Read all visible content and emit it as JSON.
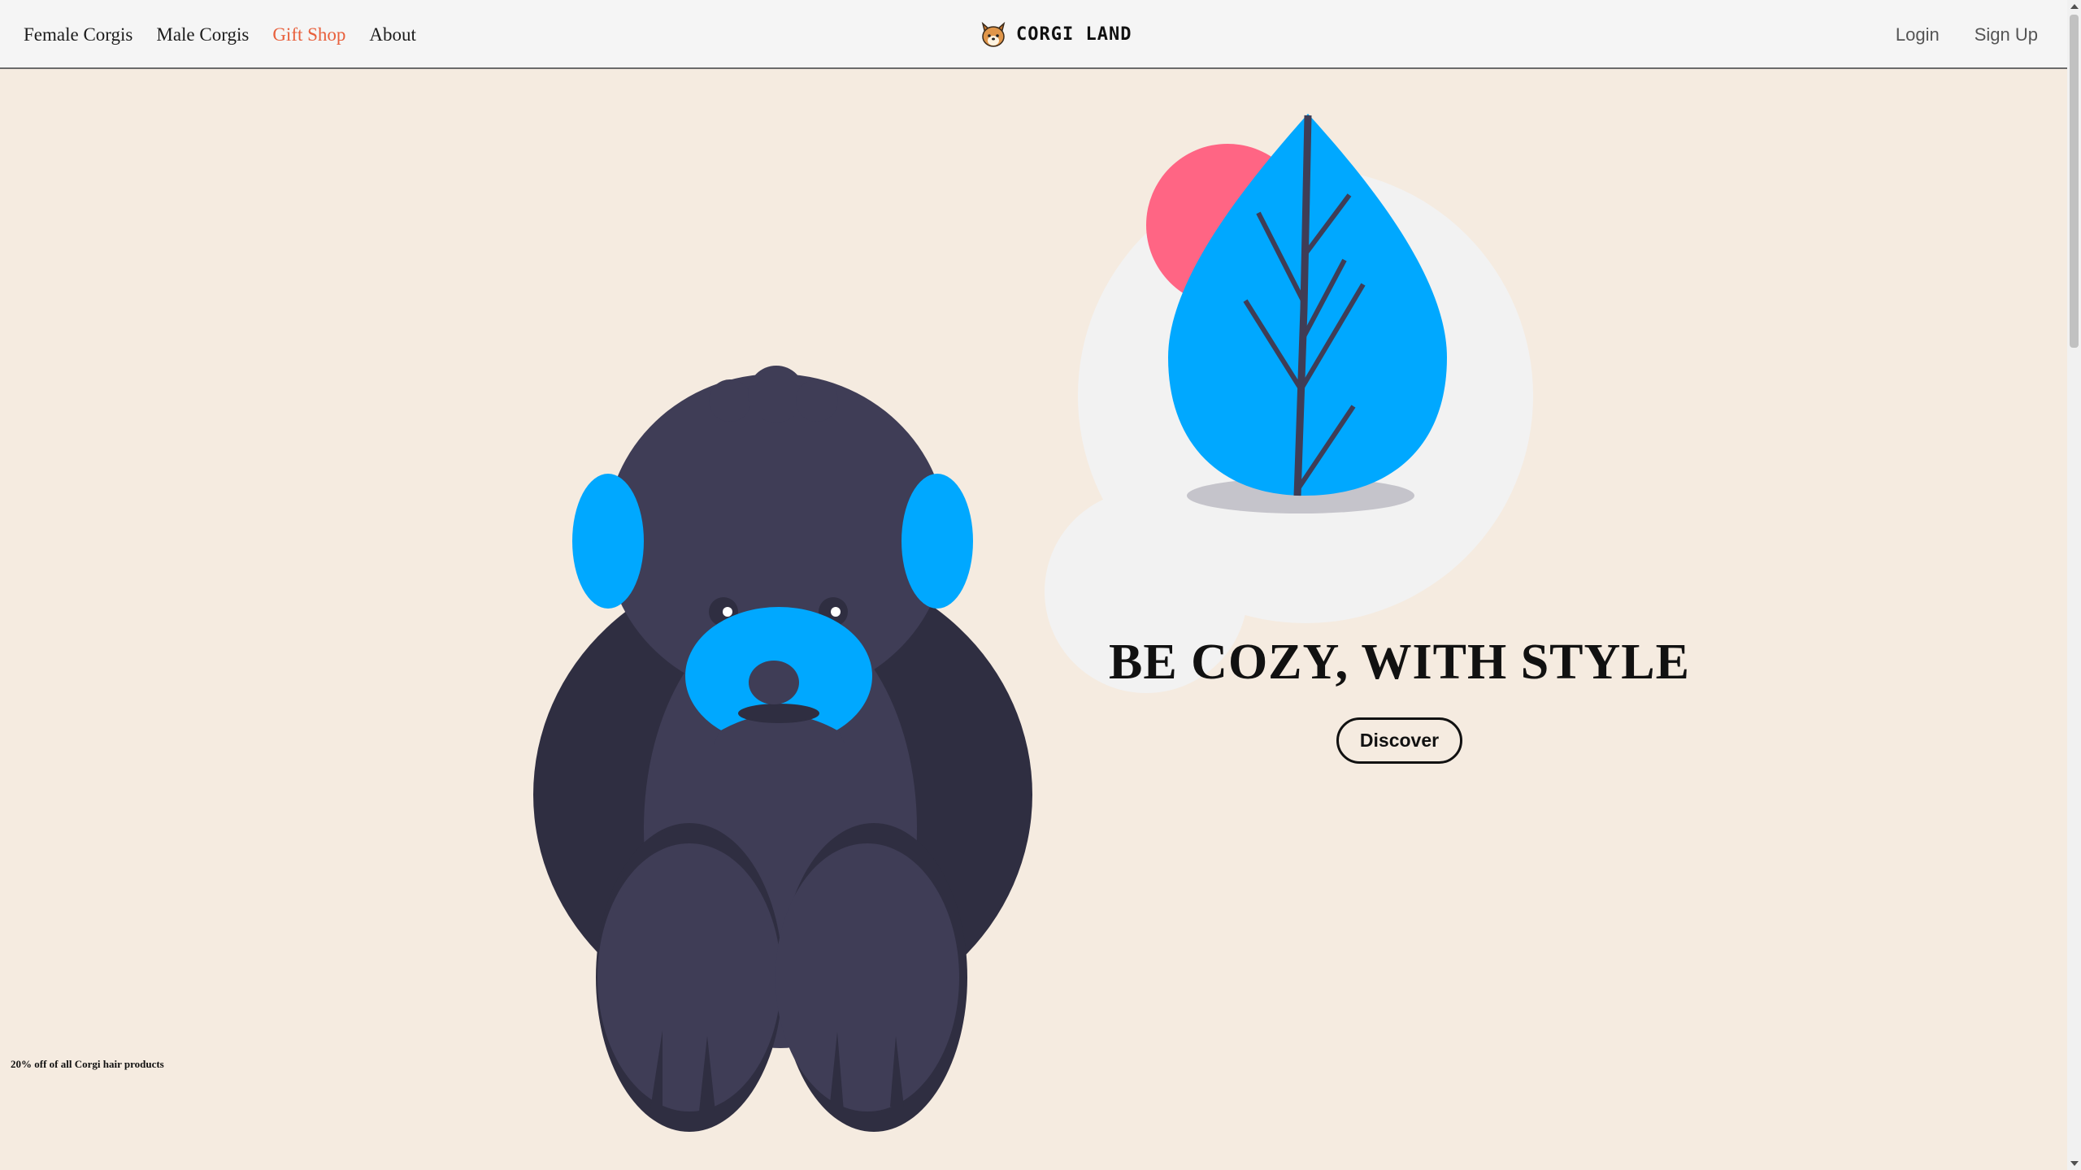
{
  "nav": {
    "links": [
      {
        "label": "Female Corgis"
      },
      {
        "label": "Male Corgis"
      },
      {
        "label": "Gift Shop"
      },
      {
        "label": "About"
      }
    ],
    "active_link": "Gift Shop",
    "brand": "CORGI LAND",
    "brand_icon": "corgi-face-icon",
    "login": "Login",
    "signup": "Sign Up"
  },
  "hero": {
    "headline": "BE COZY, WITH STYLE",
    "cta": "Discover",
    "illustrations": [
      "gorilla-illustration",
      "leaf-illustration"
    ]
  },
  "promo": "20% off of all Corgi hair products",
  "colors": {
    "background": "#f5ebe0",
    "navbar": "#f5f5f5",
    "active_link": "#e8603c",
    "accent_blue": "#00a8ff",
    "accent_pink": "#ff6584",
    "dark_figure": "#3f3d56"
  }
}
